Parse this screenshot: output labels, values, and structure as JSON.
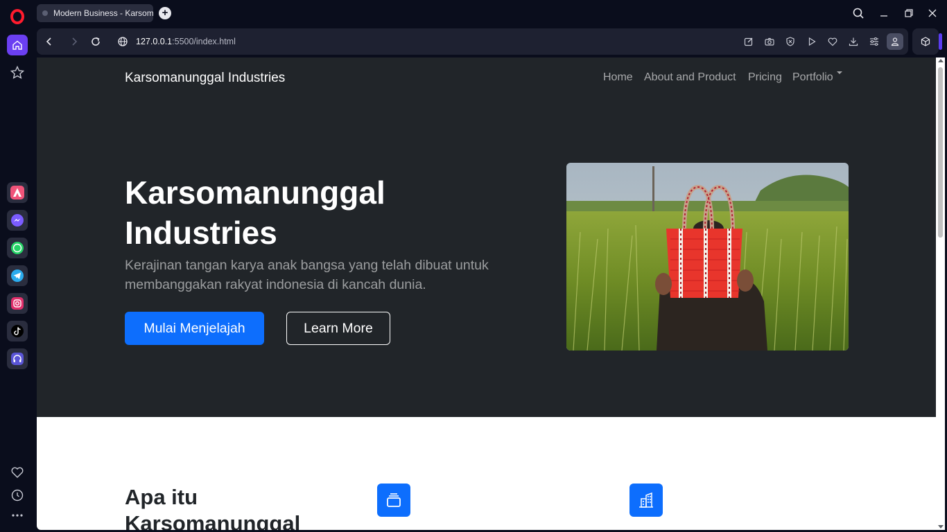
{
  "browser": {
    "tab_title": "Modern Business - Karsomanunggal Industries",
    "url_host": "127.0.0.1",
    "url_path": ":5500/index.html"
  },
  "site": {
    "brand": "Karsomanunggal Industries",
    "nav": [
      {
        "label": "Home"
      },
      {
        "label": "About and Product"
      },
      {
        "label": "Pricing"
      },
      {
        "label": "Portfolio"
      }
    ]
  },
  "hero": {
    "title_line1": "Karsomanunggal",
    "title_line2": "Industries",
    "lead_line1": "Kerajinan tangan karya anak bangsa yang telah dibuat untuk",
    "lead_line2": "membanggakan rakyat indonesia di kancah dunia.",
    "primary_button": "Mulai Menjelajah",
    "secondary_button": "Learn More"
  },
  "features": {
    "title_line1": "Apa itu",
    "title_line2": "Karsomanunggal"
  },
  "colors": {
    "hero_bg": "#212529",
    "primary": "#0d6efd",
    "sidebar_active": "#6b3ff2"
  }
}
